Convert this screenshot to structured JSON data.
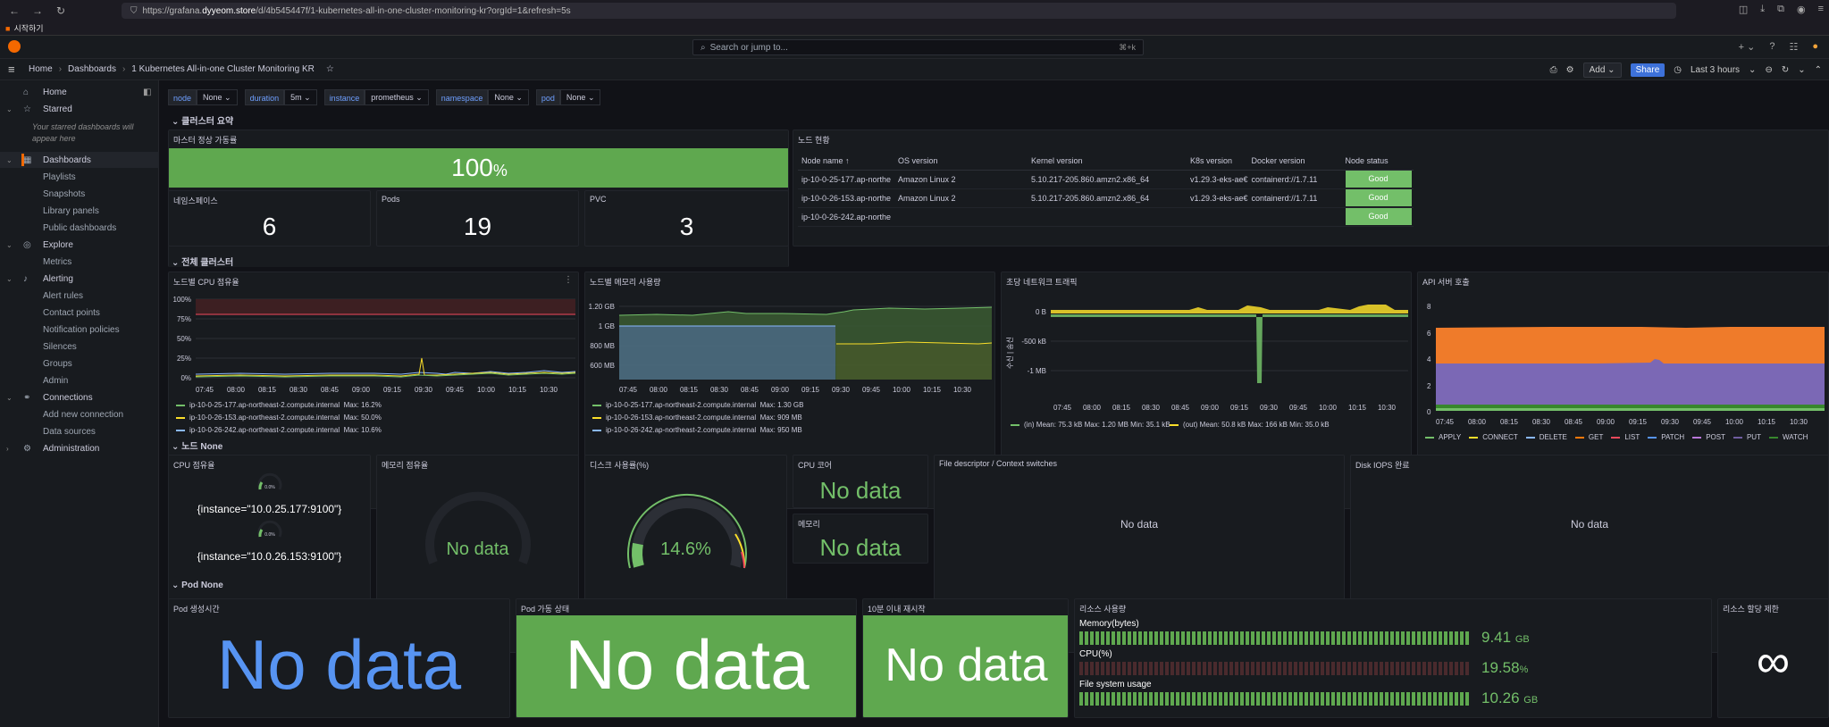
{
  "browser": {
    "url_prefix": "https://grafana.",
    "url_domain": "dyyeom.store",
    "url_path": "/d/4b545447f/1-kubernetes-all-in-one-cluster-monitoring-kr?orgId=1&refresh=5s",
    "bookmark": "시작하기"
  },
  "topbar": {
    "search_placeholder": "Search or jump to...",
    "search_shortcut": "⌘+k"
  },
  "breadcrumb": {
    "home": "Home",
    "dashboards": "Dashboards",
    "current": "1 Kubernetes All-in-one Cluster Monitoring KR"
  },
  "actions": {
    "add": "Add",
    "share": "Share",
    "time_range": "Last 3 hours"
  },
  "sidebar": {
    "home": "Home",
    "starred": "Starred",
    "starred_note": "Your starred dashboards will appear here",
    "dashboards": "Dashboards",
    "playlists": "Playlists",
    "snapshots": "Snapshots",
    "library_panels": "Library panels",
    "public_dashboards": "Public dashboards",
    "explore": "Explore",
    "metrics": "Metrics",
    "alerting": "Alerting",
    "alert_rules": "Alert rules",
    "contact_points": "Contact points",
    "notification_policies": "Notification policies",
    "silences": "Silences",
    "groups": "Groups",
    "admin": "Admin",
    "connections": "Connections",
    "add_new_connection": "Add new connection",
    "data_sources": "Data sources",
    "administration": "Administration"
  },
  "variables": [
    {
      "name": "node",
      "value": "None"
    },
    {
      "name": "duration",
      "value": "5m"
    },
    {
      "name": "instance",
      "value": "prometheus"
    },
    {
      "name": "namespace",
      "value": "None"
    },
    {
      "name": "pod",
      "value": "None"
    }
  ],
  "rows": {
    "cluster_summary": "클러스터 요약",
    "all_cluster": "전체 클러스터",
    "node": "노드 None",
    "pod": "Pod None"
  },
  "summary": {
    "master_title": "마스터 정상 가동률",
    "master_value": "100",
    "master_unit": "%",
    "ns_title": "네임스페이스",
    "ns_value": "6",
    "pods_title": "Pods",
    "pods_value": "19",
    "pvc_title": "PVC",
    "pvc_value": "3"
  },
  "node_table": {
    "title": "노드 현황",
    "headers": [
      "Node name ↑",
      "OS version",
      "Kernel version",
      "K8s version",
      "Docker version",
      "Node status"
    ],
    "rows": [
      [
        "ip-10-0-25-177.ap-northe",
        "Amazon Linux 2",
        "5.10.217-205.860.amzn2.x86_64",
        "v1.29.3-eks-ae€",
        "containerd://1.7.11",
        "Good"
      ],
      [
        "ip-10-0-26-153.ap-northe",
        "Amazon Linux 2",
        "5.10.217-205.860.amzn2.x86_64",
        "v1.29.3-eks-ae€",
        "containerd://1.7.11",
        "Good"
      ],
      [
        "ip-10-0-26-242.ap-northe",
        "",
        "",
        "",
        "",
        "Good"
      ]
    ]
  },
  "cpu_panel": {
    "title": "노드별 CPU 점유율",
    "yticks": [
      "100%",
      "75%",
      "50%",
      "25%",
      "0%"
    ],
    "xticks": [
      "07:45",
      "08:00",
      "08:15",
      "08:30",
      "08:45",
      "09:00",
      "09:15",
      "09:30",
      "09:45",
      "10:00",
      "10:15",
      "10:30"
    ],
    "legend": [
      {
        "name": "ip-10-0-25-177.ap-northeast-2.compute.internal",
        "max": "Max: 16.2%",
        "color": "#73bf69"
      },
      {
        "name": "ip-10-0-26-153.ap-northeast-2.compute.internal",
        "max": "Max: 50.0%",
        "color": "#fade2a"
      },
      {
        "name": "ip-10-0-26-242.ap-northeast-2.compute.internal",
        "max": "Max: 10.6%",
        "color": "#8ab8ff"
      }
    ]
  },
  "mem_panel": {
    "title": "노드별 메모리 사용량",
    "yticks": [
      "1.20 GB",
      "1 GB",
      "800 MB",
      "600 MB"
    ],
    "xticks": [
      "07:45",
      "08:00",
      "08:15",
      "08:30",
      "08:45",
      "09:00",
      "09:15",
      "09:30",
      "09:45",
      "10:00",
      "10:15",
      "10:30"
    ],
    "legend": [
      {
        "name": "ip-10-0-25-177.ap-northeast-2.compute.internal",
        "max": "Max: 1.30 GB",
        "color": "#73bf69"
      },
      {
        "name": "ip-10-0-26-153.ap-northeast-2.compute.internal",
        "max": "Max: 909 MB",
        "color": "#fade2a"
      },
      {
        "name": "ip-10-0-26-242.ap-northeast-2.compute.internal",
        "max": "Max: 950 MB",
        "color": "#8ab8ff"
      }
    ]
  },
  "net_panel": {
    "title": "초당 네트워크 트래픽",
    "ylabel": "수신 | 송신",
    "yticks": [
      "0 B",
      "-500 kB",
      "-1 MB"
    ],
    "xticks": [
      "07:45",
      "08:00",
      "08:15",
      "08:30",
      "08:45",
      "09:00",
      "09:15",
      "09:30",
      "09:45",
      "10:00",
      "10:15",
      "10:30"
    ],
    "legend_in": "(in)  Mean: 75.3 kB  Max: 1.20 MB  Min: 35.1 kB",
    "legend_out": "(out)  Mean: 50.8 kB  Max: 166 kB  Min: 35.0 kB"
  },
  "api_panel": {
    "title": "API 서버 호출",
    "yticks": [
      "8",
      "6",
      "4",
      "2",
      "0"
    ],
    "xticks": [
      "07:45",
      "08:00",
      "08:15",
      "08:30",
      "08:45",
      "09:00",
      "09:15",
      "09:30",
      "09:45",
      "10:00",
      "10:15",
      "10:30"
    ],
    "legend": [
      {
        "name": "APPLY",
        "color": "#73bf69"
      },
      {
        "name": "CONNECT",
        "color": "#fade2a"
      },
      {
        "name": "DELETE",
        "color": "#8ab8ff"
      },
      {
        "name": "GET",
        "color": "#ff780a"
      },
      {
        "name": "LIST",
        "color": "#f2495c"
      },
      {
        "name": "PATCH",
        "color": "#5794f2"
      },
      {
        "name": "POST",
        "color": "#b877d9"
      },
      {
        "name": "PUT",
        "color": "#705da0"
      },
      {
        "name": "WATCH",
        "color": "#37872d"
      }
    ]
  },
  "node_row": {
    "cpu_title": "CPU 점유율",
    "cpu_gauge_small": "0.0%",
    "cpu_gauge_small2": "0.0%",
    "cpu_inst1": "{instance=\"10.0.25.177:9100\"}",
    "cpu_inst2": "{instance=\"10.0.26.153:9100\"}",
    "mem_title": "메모리 점유율",
    "mem_value": "No data",
    "disk_title": "디스크 사용률(%)",
    "disk_value": "14.6%",
    "core_title": "CPU 코어",
    "core_value": "No data",
    "memsmall_title": "메모리",
    "memsmall_value": "No data",
    "fd_title": "File descriptor / Context switches",
    "fd_value": "No data",
    "iops_title": "Disk IOPS 완료",
    "iops_value": "No data"
  },
  "pod_row": {
    "created_title": "Pod 생성시간",
    "created_value": "No data",
    "status_title": "Pod 가동 상태",
    "status_value": "No data",
    "restart_title": "10분 이내 재시작",
    "restart_value": "No data",
    "resource_title": "리소스 사용량",
    "mem_label": "Memory(bytes)",
    "mem_value": "9.41",
    "mem_unit": "GB",
    "cpu_label": "CPU(%)",
    "cpu_value": "19.58",
    "cpu_unit": "%",
    "fs_label": "File system usage",
    "fs_value": "10.26",
    "fs_unit": "GB",
    "limit_title": "리소스 할당 제한",
    "limit_value": "∞"
  }
}
